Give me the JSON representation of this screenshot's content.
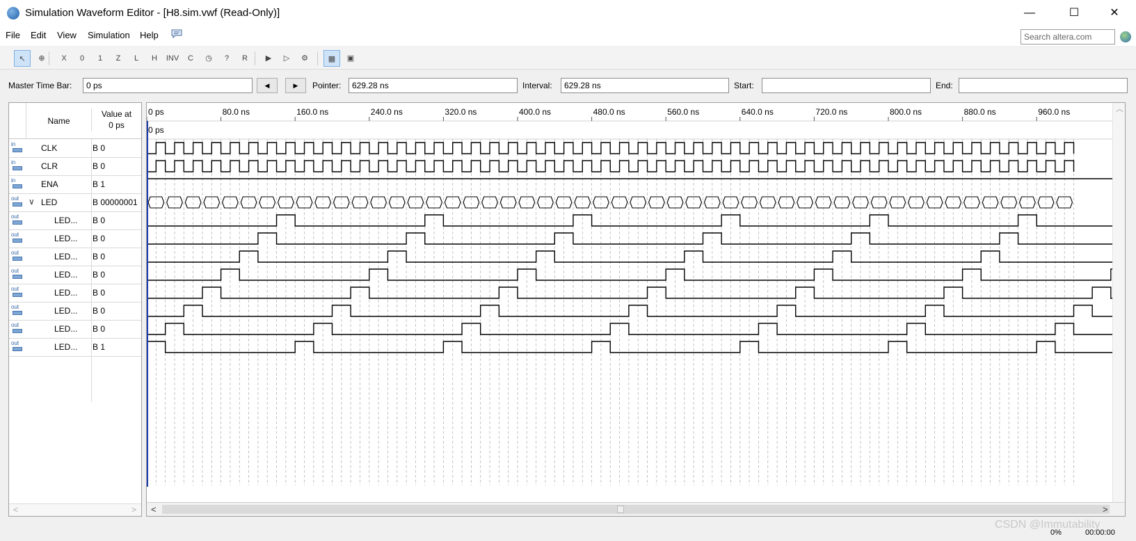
{
  "window": {
    "title": "Simulation Waveform Editor - [H8.sim.vwf (Read-Only)]",
    "minimize": "—",
    "maximize": "☐",
    "close": "✕"
  },
  "menu": [
    {
      "label": "File"
    },
    {
      "label": "Edit"
    },
    {
      "label": "View"
    },
    {
      "label": "Simulation"
    },
    {
      "label": "Help"
    }
  ],
  "search": {
    "placeholder": "Search altera.com"
  },
  "toolbar": {
    "buttons": [
      {
        "name": "select-tool-icon",
        "glyph": "↖",
        "active": true
      },
      {
        "name": "zoom-tool-icon",
        "glyph": "⊕",
        "active": false
      },
      {
        "name": "force-unknown-icon",
        "glyph": "X",
        "active": false
      },
      {
        "name": "force-low-icon",
        "glyph": "0",
        "active": false
      },
      {
        "name": "force-high-icon",
        "glyph": "1",
        "active": false
      },
      {
        "name": "force-high-impedance-icon",
        "glyph": "Z",
        "active": false
      },
      {
        "name": "force-weak-low-icon",
        "glyph": "L",
        "active": false
      },
      {
        "name": "force-weak-high-icon",
        "glyph": "H",
        "active": false
      },
      {
        "name": "invert-icon",
        "glyph": "INV",
        "active": false
      },
      {
        "name": "count-value-icon",
        "glyph": "C",
        "active": false
      },
      {
        "name": "overwrite-clock-icon",
        "glyph": "◷",
        "active": false
      },
      {
        "name": "arbitrary-value-icon",
        "glyph": "?",
        "active": false
      },
      {
        "name": "random-value-icon",
        "glyph": "R",
        "active": false
      },
      {
        "name": "run-functional-simulation-icon",
        "glyph": "▶",
        "active": false
      },
      {
        "name": "run-timing-simulation-icon",
        "glyph": "▷",
        "active": false
      },
      {
        "name": "generate-netlist-icon",
        "glyph": "⚙",
        "active": false
      },
      {
        "name": "grid-snap-icon",
        "glyph": "▦",
        "active": true
      },
      {
        "name": "group-icon",
        "glyph": "▣",
        "active": false
      }
    ]
  },
  "timebar": {
    "master_label": "Master Time Bar:",
    "master_value": "0 ps",
    "pointer_label": "Pointer:",
    "pointer_value": "629.28 ns",
    "interval_label": "Interval:",
    "interval_value": "629.28 ns",
    "start_label": "Start:",
    "start_value": "",
    "end_label": "End:",
    "end_value": ""
  },
  "signals": {
    "header_name": "Name",
    "header_value": "Value at",
    "header_value_time": "0 ps",
    "rows": [
      {
        "io": "in",
        "name": "CLK",
        "value": "B 0",
        "indent": false,
        "group": false
      },
      {
        "io": "in",
        "name": "CLR",
        "value": "B 0",
        "indent": false,
        "group": false
      },
      {
        "io": "in",
        "name": "ENA",
        "value": "B 1",
        "indent": false,
        "group": false
      },
      {
        "io": "out",
        "name": "LED",
        "value": "B 00000001",
        "indent": false,
        "group": true
      },
      {
        "io": "out",
        "name": "LED...",
        "value": "B 0",
        "indent": true,
        "group": false
      },
      {
        "io": "out",
        "name": "LED...",
        "value": "B 0",
        "indent": true,
        "group": false
      },
      {
        "io": "out",
        "name": "LED...",
        "value": "B 0",
        "indent": true,
        "group": false
      },
      {
        "io": "out",
        "name": "LED...",
        "value": "B 0",
        "indent": true,
        "group": false
      },
      {
        "io": "out",
        "name": "LED...",
        "value": "B 0",
        "indent": true,
        "group": false
      },
      {
        "io": "out",
        "name": "LED...",
        "value": "B 0",
        "indent": true,
        "group": false
      },
      {
        "io": "out",
        "name": "LED...",
        "value": "B 0",
        "indent": true,
        "group": false
      },
      {
        "io": "out",
        "name": "LED...",
        "value": "B 1",
        "indent": true,
        "group": false
      }
    ]
  },
  "waveform": {
    "ruler_labels": [
      "0 ps",
      "80.0 ns",
      "160.0 ns",
      "240.0 ns",
      "320.0 ns",
      "400.0 ns",
      "480.0 ns",
      "560.0 ns",
      "640.0 ns",
      "720.0 ns",
      "800.0 ns",
      "880.0 ns",
      "960.0 ns"
    ],
    "master_time_label": "0 ps",
    "view_end_ns": 1000,
    "clock_period_ns": 20,
    "grid_step_ns": 10,
    "colors": {
      "wave": "#000000",
      "cursor": "#1f3fae",
      "grid": "#b5b5b5"
    }
  },
  "status": {
    "percent": "0%",
    "time": "00:00:00"
  },
  "watermark": "CSDN @Immutability"
}
